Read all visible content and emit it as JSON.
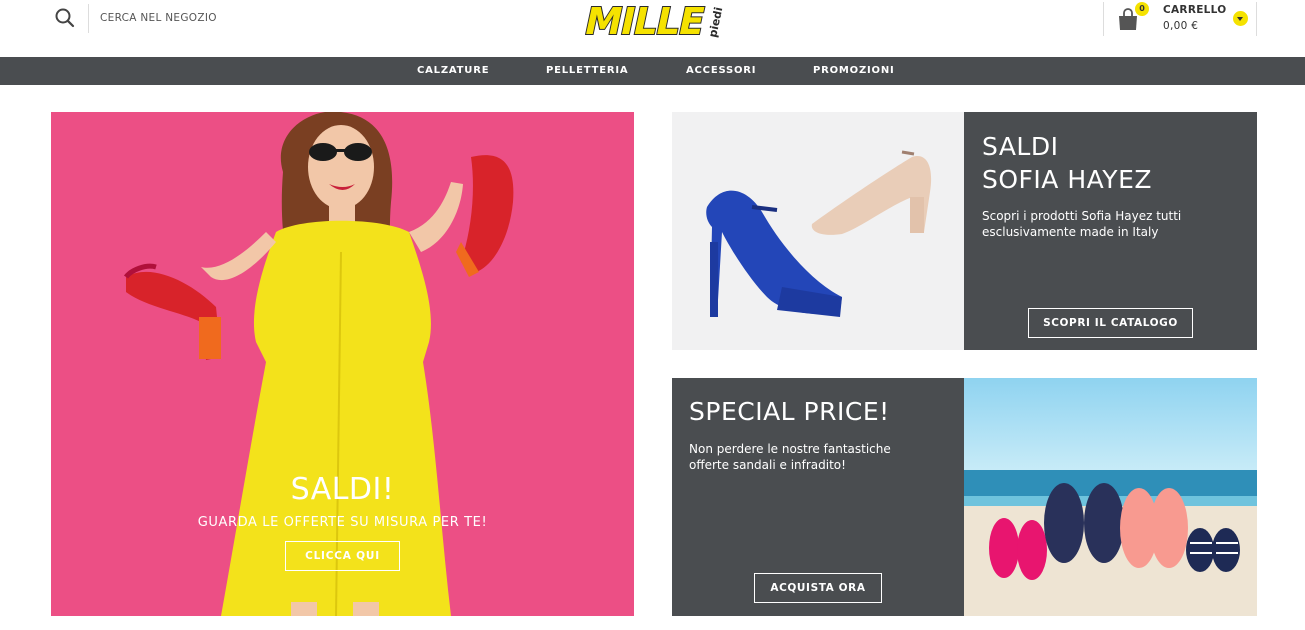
{
  "header": {
    "search_placeholder": "CERCA NEL NEGOZIO",
    "search_icon": "search-icon",
    "logo_text": "MILLE",
    "logo_subtext": "piedi",
    "cart": {
      "label": "CARRELLO",
      "amount": "0,00 €",
      "count": "0",
      "icon": "shopping-bag-icon"
    }
  },
  "nav": {
    "items": [
      {
        "label": "CALZATURE"
      },
      {
        "label": "PELLETTERIA"
      },
      {
        "label": "ACCESSORI"
      },
      {
        "label": "PROMOZIONI"
      }
    ]
  },
  "hero": {
    "title": "SALDI!",
    "subtitle": "GUARDA LE OFFERTE SU MISURA PER TE!",
    "button": "CLICCA QUI"
  },
  "promo_sofia": {
    "title_line1": "SALDI",
    "title_line2": "SOFIA HAYEZ",
    "description": "Scopri i prodotti Sofia Hayez tutti esclusivamente made in Italy",
    "button": "SCOPRI IL CATALOGO"
  },
  "promo_special": {
    "title": "SPECIAL PRICE!",
    "description": "Non perdere le nostre fantastiche offerte sandali e infradito!",
    "button": "ACQUISTA ORA"
  },
  "colors": {
    "brand_yellow": "#f5e200",
    "nav_gray": "#4a4d50",
    "hero_pink": "#ec4f85"
  }
}
